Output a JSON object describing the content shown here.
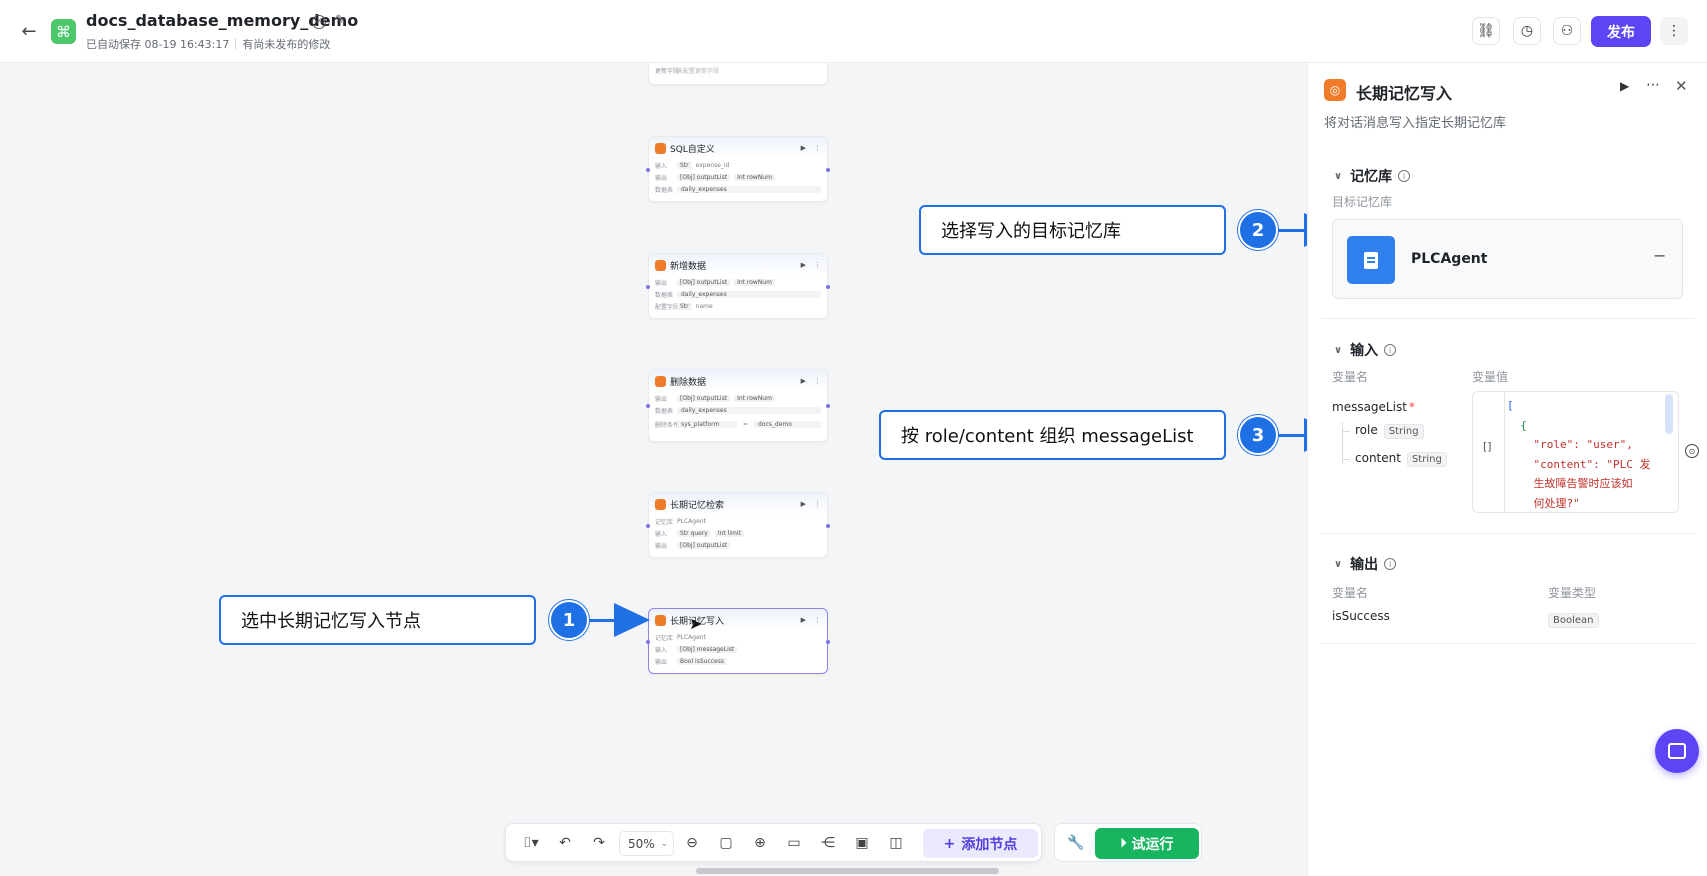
{
  "header": {
    "back_icon": "arrow-left-icon",
    "app_icon": "command-icon",
    "title": "docs_database_memory_demo",
    "autosave": "已自动保存 08-19 16:43:17",
    "unpublished": "有尚未发布的修改",
    "publish_label": "发布",
    "icons": [
      "link-icon",
      "history-icon",
      "collaborator-icon",
      "more-vertical-icon"
    ]
  },
  "canvas": {
    "nodes": [
      {
        "title": "",
        "rows": [
          {
            "label": "更新字段",
            "value": "未配置更新字段"
          }
        ]
      },
      {
        "title": "SQL自定义",
        "rows": [
          {
            "label": "输入",
            "tags": [
              "Str",
              "expense_id"
            ]
          },
          {
            "label": "输出",
            "tags": [
              "[Obj] outputList",
              "Int rowNum"
            ]
          },
          {
            "label": "数据表",
            "value": "daily_expenses"
          }
        ]
      },
      {
        "title": "新增数据",
        "rows": [
          {
            "label": "输出",
            "tags": [
              "[Obj] outputList",
              "Int rowNum"
            ]
          },
          {
            "label": "数据表",
            "value": "daily_expenses"
          },
          {
            "label": "配置字段",
            "tags": [
              "Str",
              "name"
            ]
          }
        ]
      },
      {
        "title": "删除数据",
        "rows": [
          {
            "label": "输出",
            "tags": [
              "[Obj] outputList",
              "Int rowNum"
            ]
          },
          {
            "label": "数据表",
            "value": "daily_expenses"
          },
          {
            "label": "删除条件",
            "cond": [
              "sys_platform",
              "=",
              "docs_demo"
            ]
          }
        ]
      },
      {
        "title": "长期记忆检索",
        "rows": [
          {
            "label": "记忆库",
            "value": "PLCAgent"
          },
          {
            "label": "输入",
            "tags": [
              "Str query",
              "Int limit"
            ]
          },
          {
            "label": "输出",
            "tags": [
              "[Obj] outputList"
            ]
          }
        ]
      },
      {
        "title": "长期记忆写入",
        "rows": [
          {
            "label": "记忆库",
            "value": "PLCAgent"
          },
          {
            "label": "输入",
            "tags": [
              "[Obj] messageList"
            ]
          },
          {
            "label": "输出",
            "tags": [
              "Bool isSuccess"
            ]
          }
        ]
      }
    ]
  },
  "annotations": [
    {
      "number": "1",
      "text": "选中长期记忆写入节点"
    },
    {
      "number": "2",
      "text": "选择写入的目标记忆库"
    },
    {
      "number": "3",
      "text": "按 role/content 组织 messageList"
    }
  ],
  "toolbar": {
    "zoom": "50%",
    "add_node": "添加节点",
    "run": "试运行",
    "icons": [
      "mouse-icon",
      "undo-icon",
      "redo-icon",
      "zoom-out-icon",
      "fit-view-icon",
      "zoom-in-icon",
      "comment-icon",
      "layout-icon",
      "minimap-icon",
      "image-icon",
      "wrench-icon"
    ]
  },
  "panel": {
    "title": "长期记忆写入",
    "description": "将对话消息写入指定长期记忆库",
    "memory_section": {
      "heading": "记忆库",
      "target_label": "目标记忆库",
      "selected": "PLCAgent"
    },
    "input_section": {
      "heading": "输入",
      "col_name": "变量名",
      "col_value": "变量值",
      "var_name": "messageList",
      "required_mark": "*",
      "fields": [
        {
          "name": "role",
          "type": "String"
        },
        {
          "name": "content",
          "type": "String"
        }
      ],
      "value_type": "[]",
      "code_lines": [
        "[",
        "  {",
        "    \"role\": \"user\",",
        "    \"content\": \"PLC 发",
        "    生故障告警时应该如",
        "    何处理?\""
      ]
    },
    "output_section": {
      "heading": "输出",
      "col_name": "变量名",
      "col_type": "变量类型",
      "var_name": "isSuccess",
      "var_type": "Boolean"
    }
  }
}
